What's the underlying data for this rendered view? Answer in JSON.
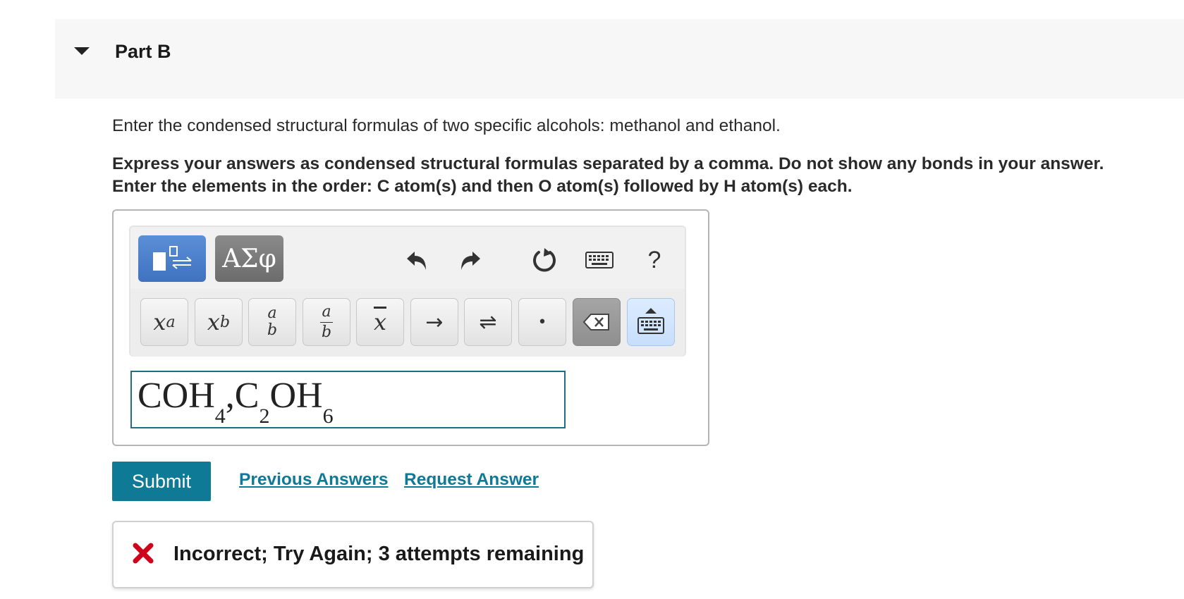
{
  "part": {
    "title": "Part B",
    "toggle_icon": "caret-down-icon"
  },
  "question": {
    "prompt": "Enter the condensed structural formulas of two specific alcohols: methanol and ethanol.",
    "instruction_line1": "Express your answers as condensed structural formulas separated by a comma. Do not show any bonds in your answer.",
    "instruction_line2": "Enter the elements in the order: C atom(s) and then O atom(s) followed by H atom(s) each."
  },
  "toolbar": {
    "templates_icon": "templates-icon",
    "greek_label": "ΑΣφ",
    "undo_icon": "undo-icon",
    "redo_icon": "redo-icon",
    "reset_icon": "reset-icon",
    "keyboard_icon": "keyboard-shortcuts-icon",
    "help_label": "?"
  },
  "keys": {
    "superscript": {
      "base": "x",
      "sup": "a"
    },
    "subscript": {
      "base": "x",
      "sub": "b"
    },
    "fraction": {
      "num": "a",
      "den": "b"
    },
    "fraction_alt": {
      "num": "a",
      "den": "b"
    },
    "overbar": "x",
    "arrow": "→",
    "equilibrium": "⇌",
    "dot": "•",
    "backspace_icon": "backspace-icon",
    "keyboard_toggle_icon": "keyboard-toggle-icon"
  },
  "answer": {
    "parts": [
      {
        "text": "COH",
        "sub": "4"
      },
      {
        "text": ",C",
        "sub": "2"
      },
      {
        "text": "OH",
        "sub": "6"
      }
    ]
  },
  "actions": {
    "submit_label": "Submit",
    "previous_answers_label": "Previous Answers",
    "request_answer_label": "Request Answer"
  },
  "feedback": {
    "icon": "incorrect-x-icon",
    "message": "Incorrect; Try Again; 3 attempts remaining",
    "color": "#d0021b"
  },
  "colors": {
    "accent": "#0e7a96",
    "header_bg": "#f7f7f7"
  }
}
